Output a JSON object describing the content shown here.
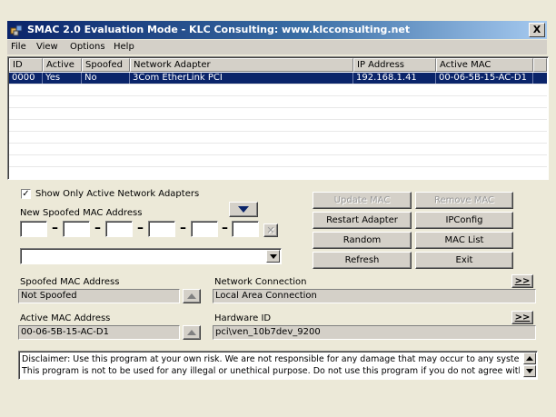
{
  "window": {
    "title": "SMAC 2.0  Evaluation Mode  -  KLC Consulting:  www.klcconsulting.net",
    "close_label": "X"
  },
  "menu": [
    "File",
    "View",
    "Options",
    "Help"
  ],
  "adapters_table": {
    "columns": [
      "ID",
      "Active",
      "Spoofed",
      "Network Adapter",
      "IP Address",
      "Active MAC"
    ],
    "rows": [
      {
        "id": "0000",
        "active": "Yes",
        "spoofed": "No",
        "adapter": "3Com EtherLink PCI",
        "ip": "192.168.1.41",
        "mac": "00-06-5B-15-AC-D1",
        "selected": true
      }
    ]
  },
  "options": {
    "show_only_active_label": "Show Only Active Network Adapters",
    "show_only_active_checked": true,
    "new_mac_label": "New Spoofed MAC Address",
    "mac_octets": [
      "",
      "",
      "",
      "",
      "",
      ""
    ],
    "mac_dropdown_value": ""
  },
  "buttons": {
    "update_mac": "Update MAC",
    "remove_mac": "Remove MAC",
    "restart_adapter": "Restart Adapter",
    "ipconfig": "IPConfig",
    "random": "Random",
    "mac_list": "MAC List",
    "refresh": "Refresh",
    "exit": "Exit",
    "more": ">>"
  },
  "status": {
    "spoofed_mac_label": "Spoofed MAC Address",
    "spoofed_mac_value": "Not Spoofed",
    "active_mac_label": "Active MAC Address",
    "active_mac_value": "00-06-5B-15-AC-D1",
    "network_connection_label": "Network Connection",
    "network_connection_value": "Local Area Connection",
    "hardware_id_label": "Hardware ID",
    "hardware_id_value": "pci\\ven_10b7dev_9200"
  },
  "disclaimer": {
    "line1": "Disclaimer: Use this program at your own risk.  We are not responsible for any damage that may occur to any system.",
    "line2": "This program is not to be used for any illegal or unethical purpose.  Do not use this program if you do not agree with"
  },
  "colors": {
    "title_gradient_start": "#0a246a",
    "selection": "#0a246a",
    "face": "#d4d0c8"
  }
}
